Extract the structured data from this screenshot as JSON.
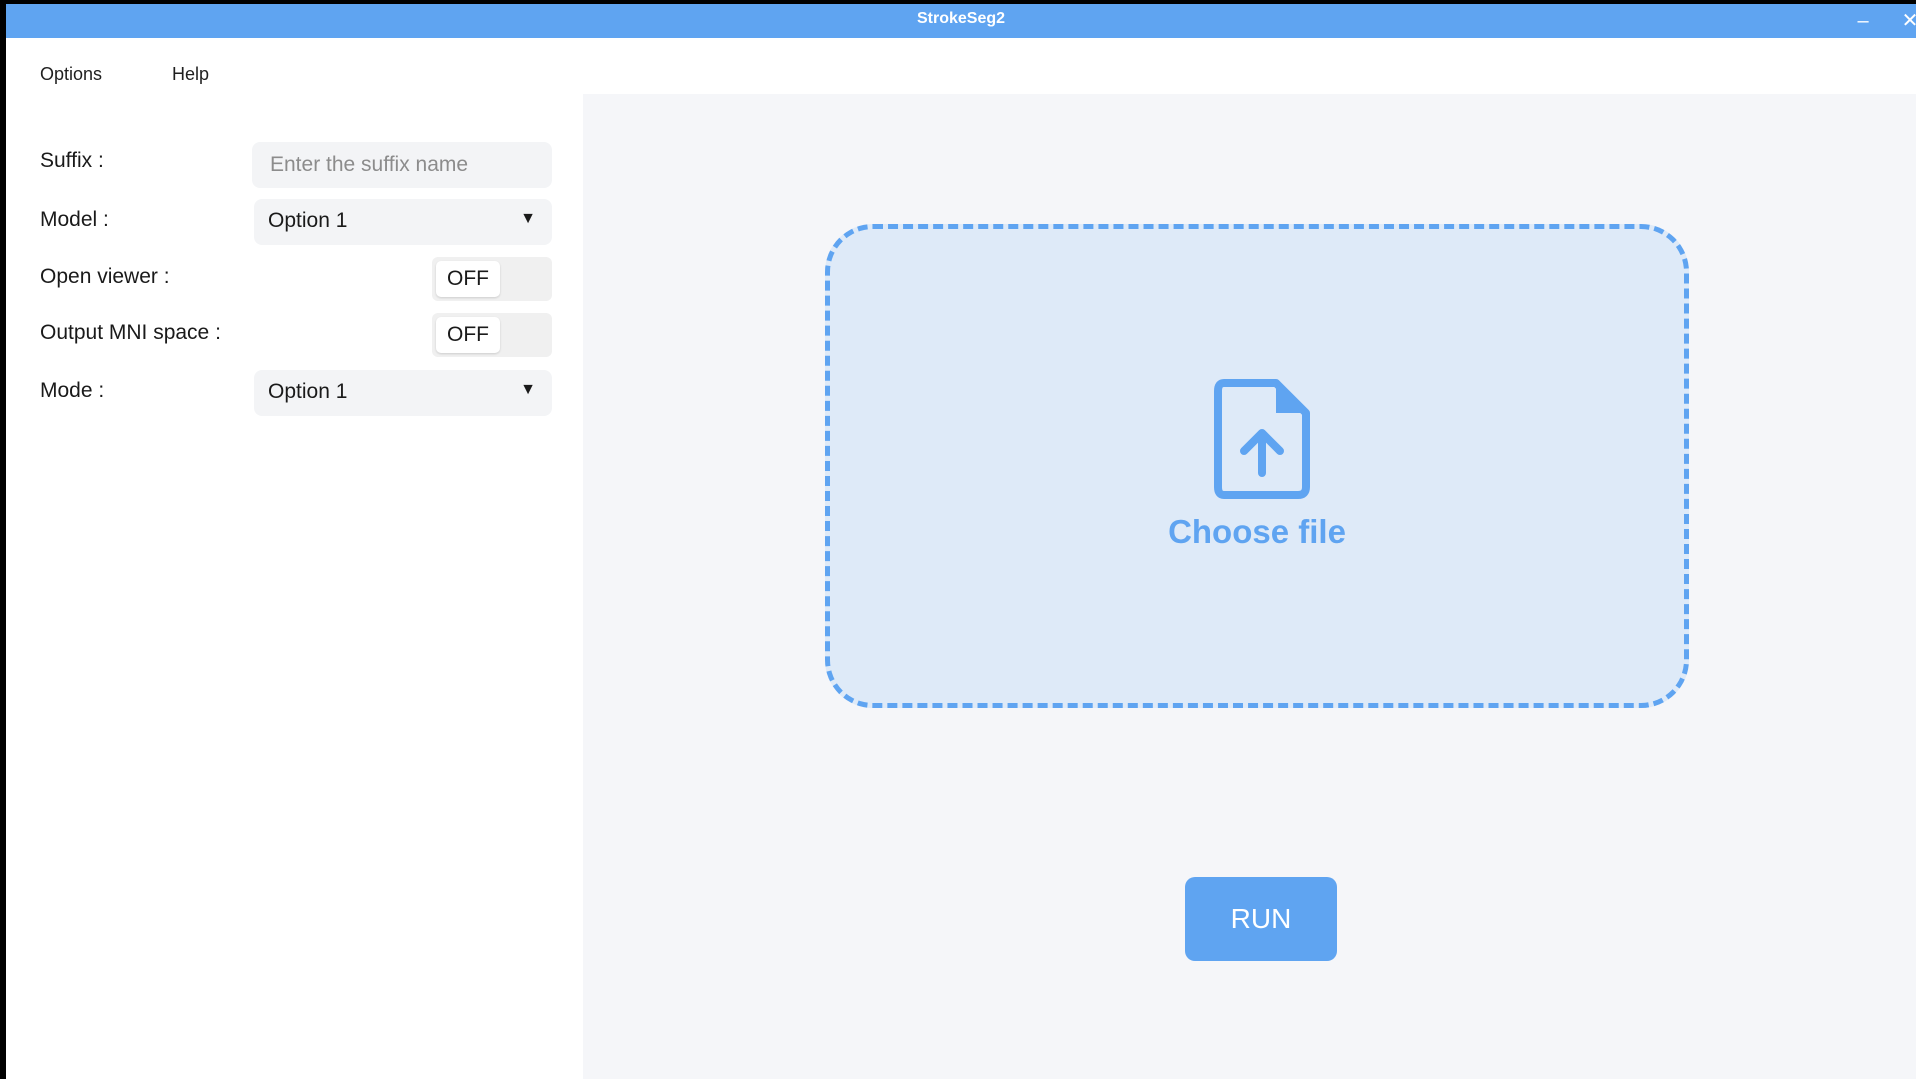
{
  "window": {
    "title": "StrokeSeg2",
    "minimize_symbol": "–",
    "close_symbol": "✕"
  },
  "menu": {
    "options": "Options",
    "help": "Help"
  },
  "form": {
    "suffix": {
      "label": "Suffix :",
      "placeholder": "Enter the suffix name",
      "value": ""
    },
    "model": {
      "label": "Model :",
      "selected": "Option 1"
    },
    "open_viewer": {
      "label": "Open viewer :",
      "state": "OFF"
    },
    "output_mni": {
      "label": "Output MNI space :",
      "state": "OFF"
    },
    "mode": {
      "label": "Mode :",
      "selected": "Option 1"
    },
    "dropdown_arrow": "▼"
  },
  "upload": {
    "label": "Choose file",
    "icon": "file-upload-icon"
  },
  "run_button": {
    "label": "RUN"
  },
  "colors": {
    "accent": "#5fa4f1",
    "dropzone_bg": "#deeaf8",
    "main_bg": "#f5f6f9"
  }
}
